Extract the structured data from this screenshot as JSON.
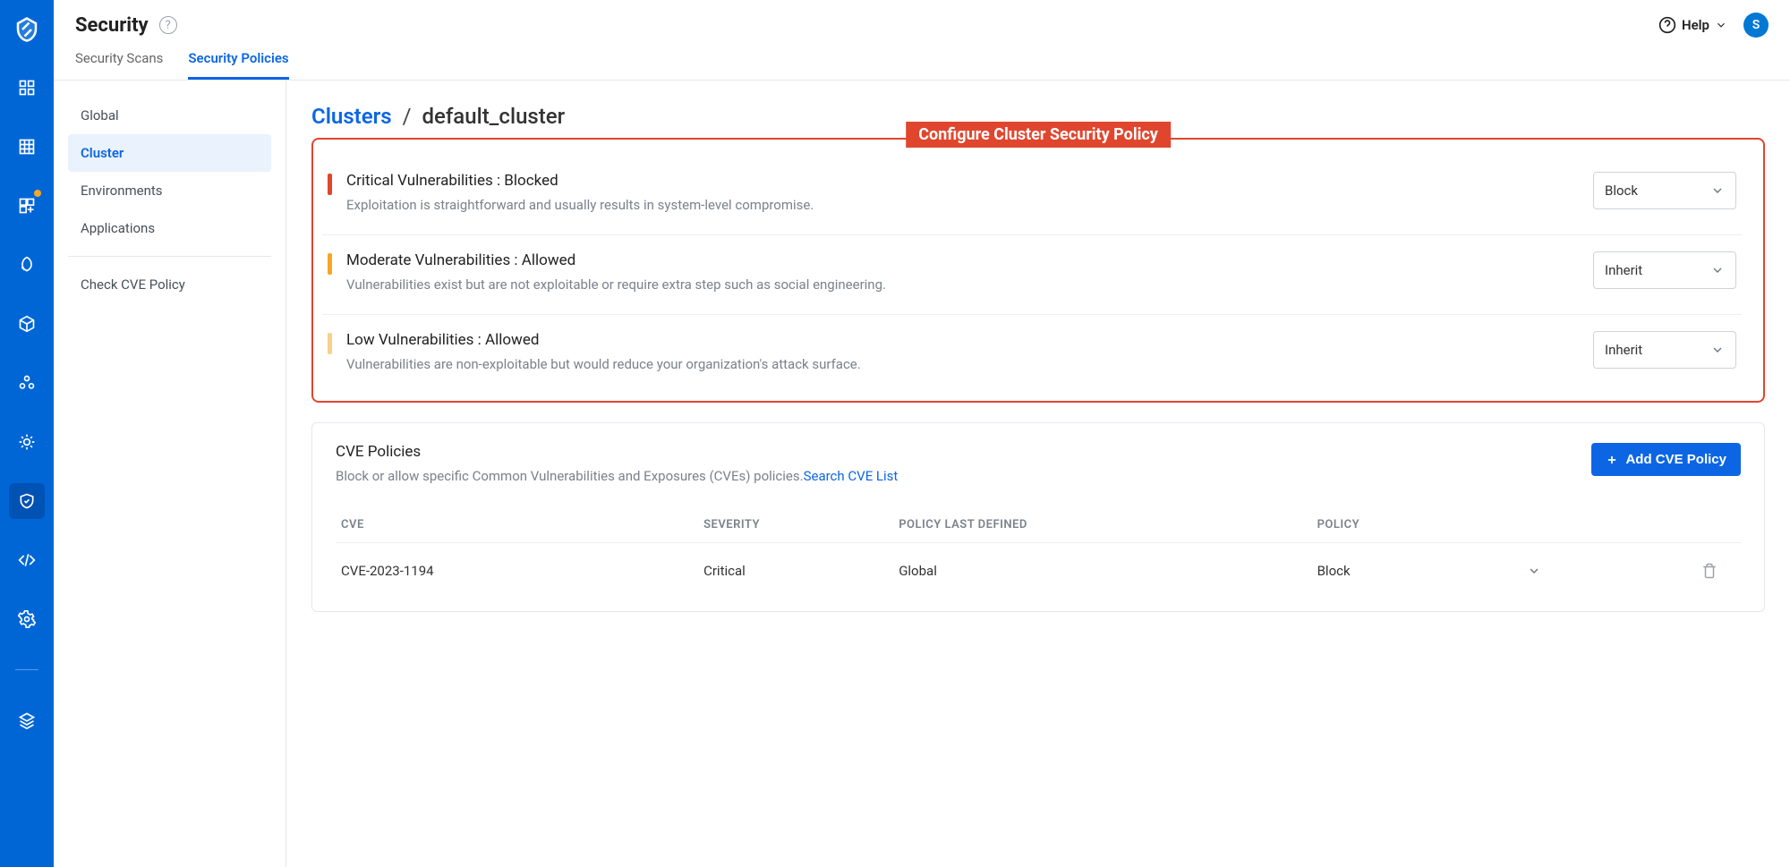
{
  "header": {
    "title": "Security",
    "help_label": "Help",
    "avatar_initial": "S",
    "tabs": {
      "scans": "Security Scans",
      "policies": "Security Policies"
    }
  },
  "sidebar": {
    "global": "Global",
    "cluster": "Cluster",
    "environments": "Environments",
    "applications": "Applications",
    "check_cve": "Check CVE Policy"
  },
  "breadcrumb": {
    "root": "Clusters",
    "sep": "/",
    "current": "default_cluster"
  },
  "callout": "Configure Cluster Security Policy",
  "vulnerabilities": {
    "critical": {
      "title": "Critical Vulnerabilities : Blocked",
      "desc": "Exploitation is straightforward and usually results in system-level compromise.",
      "selected": "Block"
    },
    "moderate": {
      "title": "Moderate Vulnerabilities : Allowed",
      "desc": "Vulnerabilities exist but are not exploitable or require extra step such as social engineering.",
      "selected": "Inherit"
    },
    "low": {
      "title": "Low Vulnerabilities : Allowed",
      "desc": "Vulnerabilities are non-exploitable but would reduce your organization's attack surface.",
      "selected": "Inherit"
    }
  },
  "cve_section": {
    "title": "CVE Policies",
    "desc": "Block or allow specific Common Vulnerabilities and Exposures (CVEs) policies.",
    "link": "Search CVE List",
    "button": "Add CVE Policy",
    "columns": {
      "cve": "CVE",
      "severity": "SEVERITY",
      "defined": "POLICY LAST DEFINED",
      "policy": "POLICY"
    },
    "rows": [
      {
        "cve": "CVE-2023-1194",
        "severity": "Critical",
        "defined": "Global",
        "policy": "Block"
      }
    ]
  }
}
